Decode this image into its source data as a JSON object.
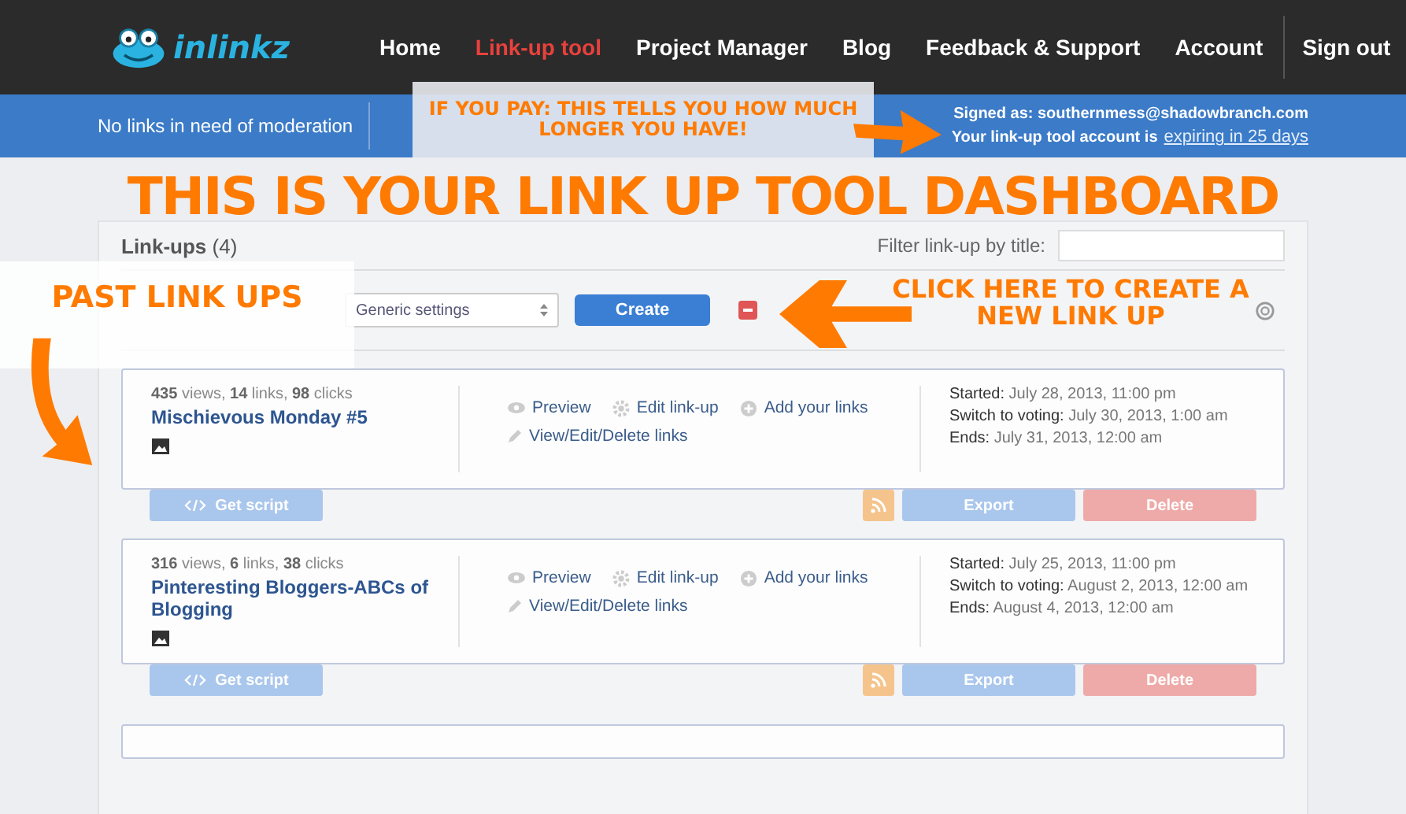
{
  "nav": {
    "logo": "inlinkz",
    "items": [
      {
        "label": "Home",
        "selected": false
      },
      {
        "label": "Link-up tool",
        "selected": true
      },
      {
        "label": "Project Manager",
        "selected": false
      },
      {
        "label": "Blog",
        "selected": false
      },
      {
        "label": "Feedback & Support",
        "selected": false
      },
      {
        "label": "Account",
        "selected": false
      },
      {
        "label": "Sign out",
        "selected": false
      }
    ]
  },
  "status_bar": {
    "moderation": "No links in need of moderation",
    "signed_as": "Signed as: southernmess@shadowbranch.com",
    "expiry_text": "Your link-up tool account is",
    "expiry_link": "expiring in 25 days"
  },
  "linkups": {
    "title": "Link-ups",
    "count": "(4)",
    "filter_label": "Filter link-up by title:",
    "select": "Generic settings",
    "create": "Create"
  },
  "cards": [
    {
      "stats": "**435** views, **14** links, **98** clicks",
      "title": "Mischievous Monday #5",
      "actions": [
        "Preview",
        "Edit link-up",
        "Add your links",
        "View/Edit/Delete links"
      ],
      "dates": [
        {
          "label": "Started:",
          "value": "July 28, 2013, 11:00 pm"
        },
        {
          "label": "Switch to voting:",
          "value": "July 30, 2013, 1:00 am"
        },
        {
          "label": "Ends:",
          "value": "July 31, 2013, 12:00 am"
        }
      ],
      "buttons": [
        "Get script",
        "Export",
        "Delete"
      ]
    },
    {
      "stats": "**316** views, **6** links, **38** clicks",
      "title": "Pinteresting Bloggers-ABCs of Blogging",
      "actions": [
        "Preview",
        "Edit link-up",
        "Add your links",
        "View/Edit/Delete links"
      ],
      "dates": [
        {
          "label": "Started:",
          "value": "July 25, 2013, 11:00 pm"
        },
        {
          "label": "Switch to voting:",
          "value": "August 2, 2013, 12:00 am"
        },
        {
          "label": "Ends:",
          "value": "August 4, 2013, 12:00 am"
        }
      ],
      "buttons": [
        "Get script",
        "Export",
        "Delete"
      ]
    }
  ],
  "annotations": [
    {
      "kind": "banner",
      "text": "IF YOU PAY: THIS TELLS YOU HOW MUCH LONGER YOU HAVE!"
    },
    {
      "kind": "title",
      "text": "THIS IS YOUR LINK UP TOOL DASHBOARD"
    },
    {
      "kind": "label",
      "text": "PAST LINK UPS"
    },
    {
      "kind": "callout",
      "text": "CLICK HERE TO CREATE A NEW LINK UP"
    }
  ]
}
